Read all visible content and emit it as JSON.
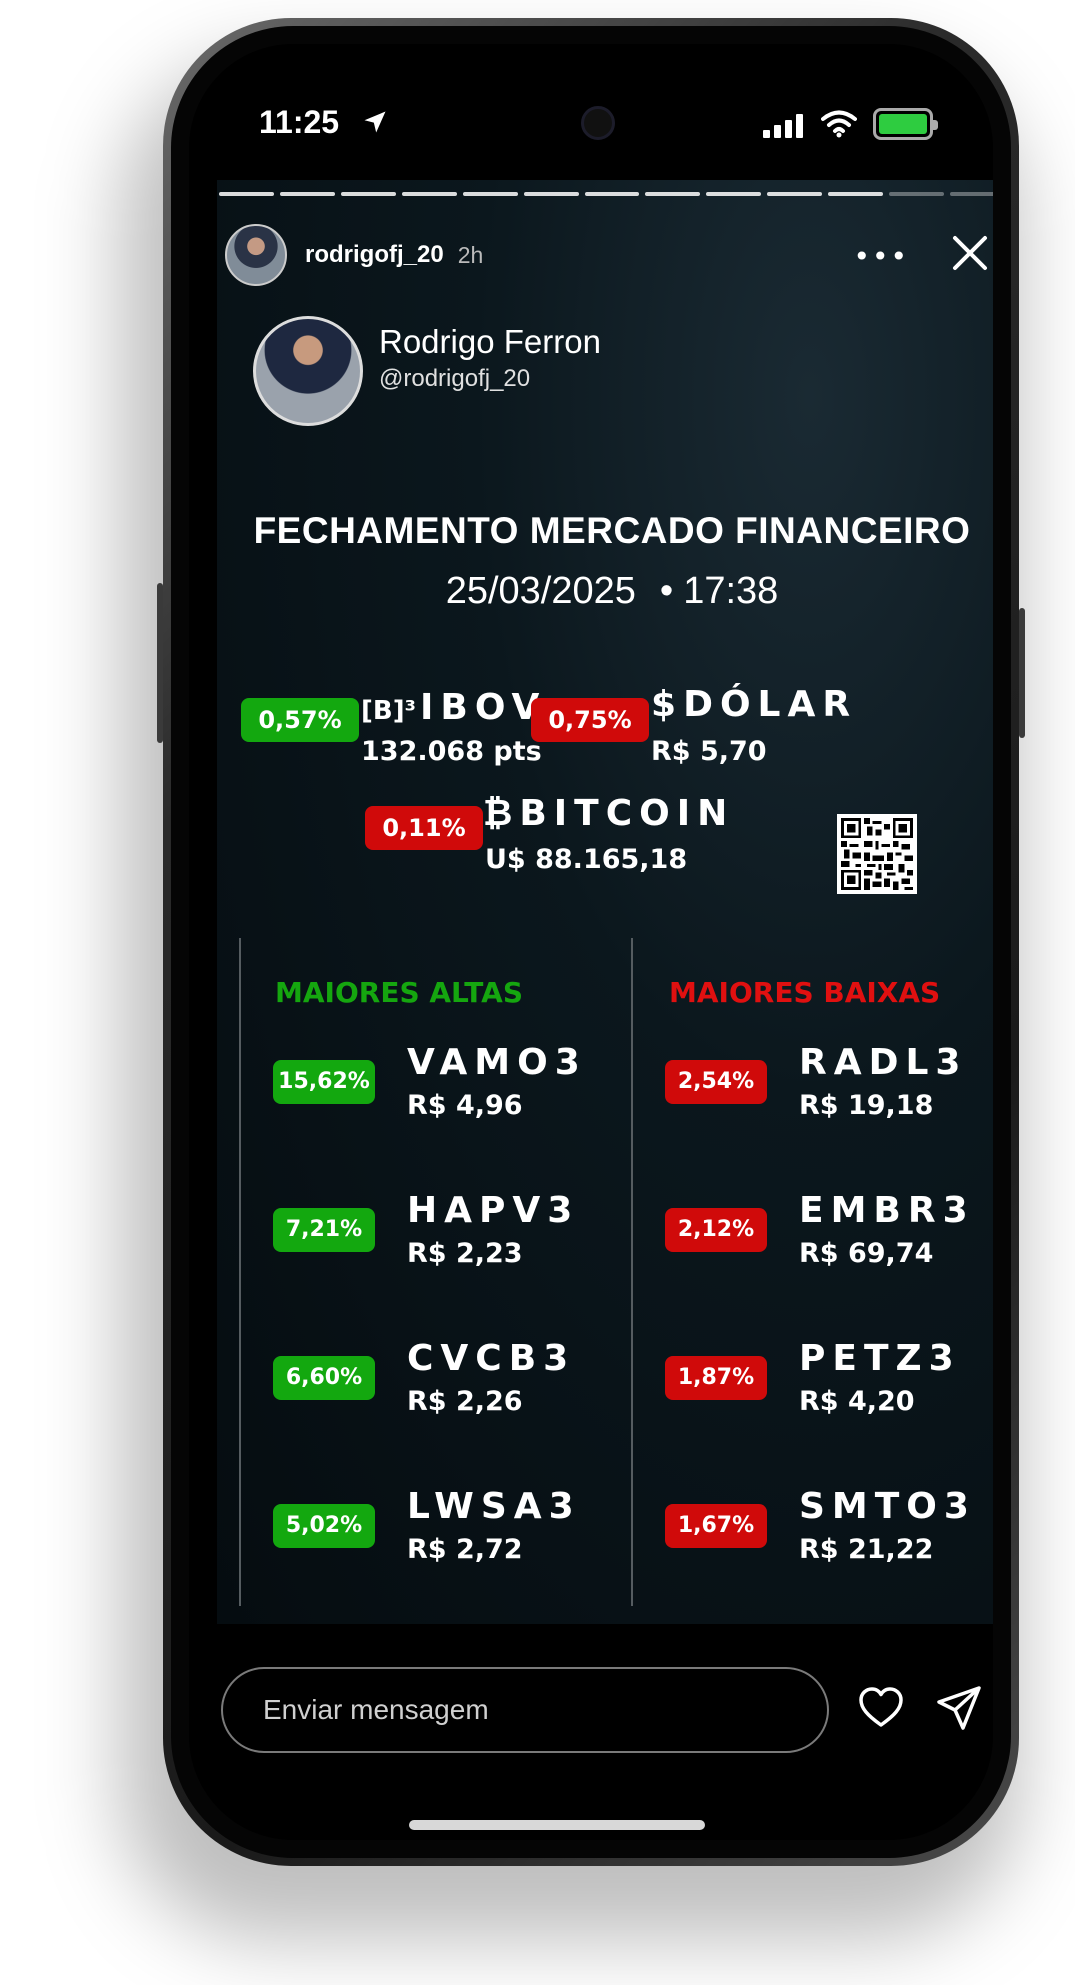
{
  "status_bar": {
    "time": "11:25",
    "icons": [
      "location-arrow-icon",
      "signal-icon",
      "wifi-icon",
      "battery-icon"
    ],
    "battery_color": "#2ecc40"
  },
  "story": {
    "username": "rodrigofj_20",
    "age": "2h",
    "more_label": "•••",
    "progress_segments": 13,
    "progress_active": 11
  },
  "profile": {
    "name": "Rodrigo Ferron",
    "handle": "@rodrigofj_20"
  },
  "report": {
    "title": "FECHAMENTO MERCADO FINANCEIRO",
    "date": "25/03/2025",
    "separator": "•",
    "time": "17:38"
  },
  "indices": {
    "ibov": {
      "change": "0,57%",
      "prefix": "[B]³",
      "name": "IBOV",
      "value": "132.068 pts",
      "direction": "up"
    },
    "dolar": {
      "change": "0,75%",
      "prefix": "$",
      "name": "DÓLAR",
      "value": "R$ 5,70",
      "direction": "down"
    },
    "bitcoin": {
      "change": "0,11%",
      "prefix": "₿",
      "name": "BITCOIN",
      "value": "U$ 88.165,18",
      "direction": "down"
    }
  },
  "gainers": {
    "title": "MAIORES ALTAS",
    "items": [
      {
        "change": "15,62%",
        "ticker": "VAMO3",
        "price": "R$ 4,96"
      },
      {
        "change": "7,21%",
        "ticker": "HAPV3",
        "price": "R$ 2,23"
      },
      {
        "change": "6,60%",
        "ticker": "CVCB3",
        "price": "R$ 2,26"
      },
      {
        "change": "5,02%",
        "ticker": "LWSA3",
        "price": "R$ 2,72"
      }
    ]
  },
  "losers": {
    "title": "MAIORES BAIXAS",
    "items": [
      {
        "change": "2,54%",
        "ticker": "RADL3",
        "price": "R$ 19,18"
      },
      {
        "change": "2,12%",
        "ticker": "EMBR3",
        "price": "R$ 69,74"
      },
      {
        "change": "1,87%",
        "ticker": "PETZ3",
        "price": "R$ 4,20"
      },
      {
        "change": "1,67%",
        "ticker": "SMTO3",
        "price": "R$ 21,22"
      }
    ]
  },
  "colors": {
    "up": "#13a80f",
    "down": "#d00a0a",
    "gainers_title": "#15a60f",
    "losers_title": "#e01010"
  },
  "reply": {
    "placeholder": "Enviar mensagem"
  }
}
